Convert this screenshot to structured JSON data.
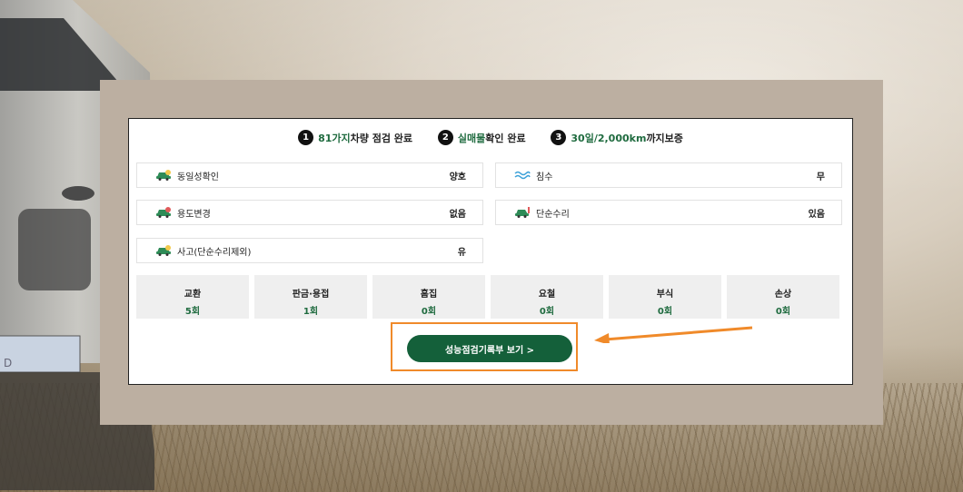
{
  "steps": [
    {
      "num": "1",
      "highlight": "81가지",
      "text": " 차량 점검 완료"
    },
    {
      "num": "2",
      "highlight": "실매물",
      "text": " 확인 완료"
    },
    {
      "num": "3",
      "highlight": "30일/2,000km",
      "text": " 까지보증"
    }
  ],
  "checks_left": [
    {
      "label": "동일성확인",
      "value": "양호",
      "icon": "car-check-icon"
    },
    {
      "label": "용도변경",
      "value": "없음",
      "icon": "car-change-icon"
    },
    {
      "label": "사고(단순수리제외)",
      "value": "유",
      "icon": "car-accident-icon"
    }
  ],
  "checks_right": [
    {
      "label": "침수",
      "value": "무",
      "icon": "water-wave-icon"
    },
    {
      "label": "단순수리",
      "value": "있음",
      "icon": "car-repair-icon"
    }
  ],
  "stats": [
    {
      "title": "교환",
      "value": "5회"
    },
    {
      "title": "판금·용접",
      "value": "1회"
    },
    {
      "title": "흠집",
      "value": "0회"
    },
    {
      "title": "요철",
      "value": "0회"
    },
    {
      "title": "부식",
      "value": "0회"
    },
    {
      "title": "손상",
      "value": "0회"
    }
  ],
  "cta": {
    "label": "성능점검기록부 보기 >"
  },
  "plate_text": "D",
  "colors": {
    "accent_green": "#1f6b3f",
    "button_green": "#14603a",
    "highlight_orange": "#f08a2a"
  }
}
